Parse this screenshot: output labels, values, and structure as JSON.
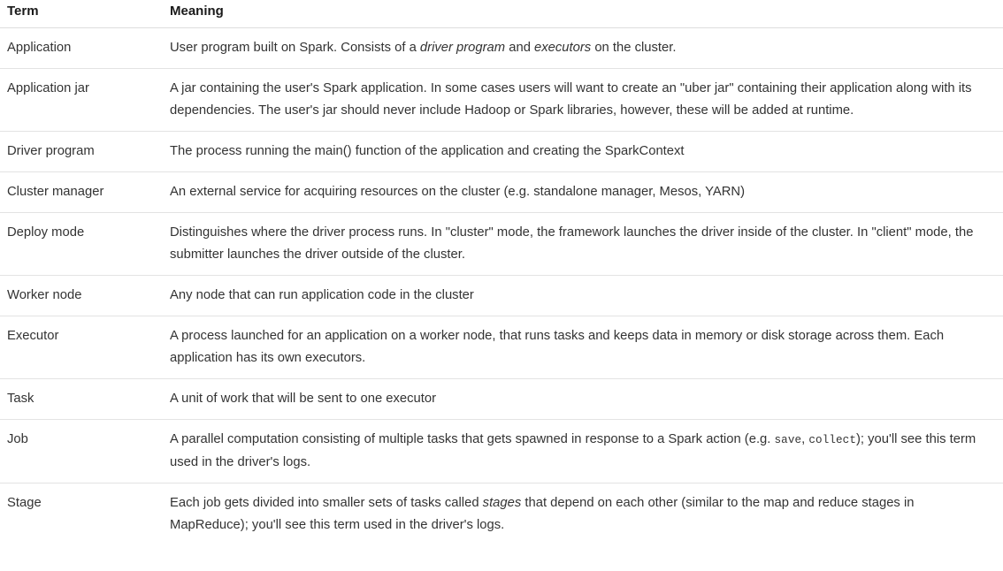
{
  "table": {
    "columns": [
      {
        "key": "term",
        "label": "Term"
      },
      {
        "key": "meaning",
        "label": "Meaning"
      }
    ],
    "rows": [
      {
        "term": "Application",
        "meaning": "User program built on Spark. Consists of a driver program and executors on the cluster.",
        "meaning_html": "User program built on Spark. Consists of a <i>driver program</i> and <i>executors</i> on the cluster."
      },
      {
        "term": "Application jar",
        "meaning": "A jar containing the user's Spark application. In some cases users will want to create an \"uber jar\" containing their application along with its dependencies. The user's jar should never include Hadoop or Spark libraries, however, these will be added at runtime.",
        "meaning_html": "A jar containing the user's Spark application. In some cases users will want to create an \"uber jar\" containing their application along with its dependencies. The user's jar should never include Hadoop or Spark libraries, however, these will be added at runtime."
      },
      {
        "term": "Driver program",
        "meaning": "The process running the main() function of the application and creating the SparkContext",
        "meaning_html": "The process running the main() function of the application and creating the SparkContext"
      },
      {
        "term": "Cluster manager",
        "meaning": "An external service for acquiring resources on the cluster (e.g. standalone manager, Mesos, YARN)",
        "meaning_html": "An external service for acquiring resources on the cluster (e.g. standalone manager, Mesos, YARN)"
      },
      {
        "term": "Deploy mode",
        "meaning": "Distinguishes where the driver process runs. In \"cluster\" mode, the framework launches the driver inside of the cluster. In \"client\" mode, the submitter launches the driver outside of the cluster.",
        "meaning_html": "Distinguishes where the driver process runs. In \"cluster\" mode, the framework launches the driver inside of the cluster. In \"client\" mode, the submitter launches the driver outside of the cluster."
      },
      {
        "term": "Worker node",
        "meaning": "Any node that can run application code in the cluster",
        "meaning_html": "Any node that can run application code in the cluster"
      },
      {
        "term": "Executor",
        "meaning": "A process launched for an application on a worker node, that runs tasks and keeps data in memory or disk storage across them. Each application has its own executors.",
        "meaning_html": "A process launched for an application on a worker node, that runs tasks and keeps data in memory or disk storage across them. Each application has its own executors."
      },
      {
        "term": "Task",
        "meaning": "A unit of work that will be sent to one executor",
        "meaning_html": "A unit of work that will be sent to one executor"
      },
      {
        "term": "Job",
        "meaning": "A parallel computation consisting of multiple tasks that gets spawned in response to a Spark action (e.g. save, collect); you'll see this term used in the driver's logs.",
        "meaning_html": "A parallel computation consisting of multiple tasks that gets spawned in response to a Spark action (e.g. <code>save</code>, <code>collect</code>); you'll see this term used in the driver's logs."
      },
      {
        "term": "Stage",
        "meaning": "Each job gets divided into smaller sets of tasks called stages that depend on each other (similar to the map and reduce stages in MapReduce); you'll see this term used in the driver's logs.",
        "meaning_html": "Each job gets divided into smaller sets of tasks called <i>stages</i> that depend on each other (similar to the map and reduce stages in MapReduce); you'll see this term used in the driver's logs."
      }
    ]
  },
  "colors": {
    "text": "#333333",
    "header_text": "#1a1a1a",
    "row_divider": "#e3e3e3",
    "header_divider": "#dddddd",
    "background": "#ffffff"
  }
}
